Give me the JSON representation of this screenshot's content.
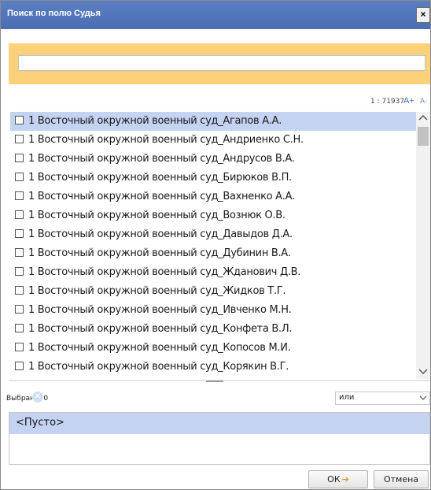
{
  "dialog": {
    "title": "Поиск по полю Судья",
    "close_label": "×"
  },
  "search": {
    "value": "",
    "placeholder": ""
  },
  "list_tools": {
    "counter": "1 : 71937",
    "font_increase": "A+",
    "font_decrease": "A-"
  },
  "items": [
    {
      "label": "1 Восточный окружной военный суд_Агапов А.А.",
      "selected": true
    },
    {
      "label": "1 Восточный окружной военный суд_Андриенко С.Н.",
      "selected": false
    },
    {
      "label": "1 Восточный окружной военный суд_Андрусов В.А.",
      "selected": false
    },
    {
      "label": "1 Восточный окружной военный суд_Бирюков В.П.",
      "selected": false
    },
    {
      "label": "1 Восточный окружной военный суд_Вахненко А.А.",
      "selected": false
    },
    {
      "label": "1 Восточный окружной военный суд_Вознюк О.В.",
      "selected": false
    },
    {
      "label": "1 Восточный окружной военный суд_Давыдов Д.А.",
      "selected": false
    },
    {
      "label": "1 Восточный окружной военный суд_Дубинин В.А.",
      "selected": false
    },
    {
      "label": "1 Восточный окружной военный суд_Жданович Д.В.",
      "selected": false
    },
    {
      "label": "1 Восточный окружной военный суд_Жидков Т.Г.",
      "selected": false
    },
    {
      "label": "1 Восточный окружной военный суд_Ивченко М.Н.",
      "selected": false
    },
    {
      "label": "1 Восточный окружной военный суд_Конфета В.Л.",
      "selected": false
    },
    {
      "label": "1 Восточный окружной военный суд_Копосов М.И.",
      "selected": false
    },
    {
      "label": "1 Восточный окружной военный суд_Корякин В.Г.",
      "selected": false
    }
  ],
  "selection": {
    "label": "Выбрано: 0",
    "operator": "или",
    "result": "<Пусто>"
  },
  "buttons": {
    "ok": "ОК",
    "cancel": "Отмена"
  },
  "icons": {
    "scroll_up": "chevron-up-icon",
    "scroll_down": "chevron-down-icon",
    "clear": "clear-icon",
    "ok_arrow": "arrow-right-icon"
  },
  "colors": {
    "titlebar": "#4a6db4",
    "search_panel": "#fdd17a",
    "selection_highlight": "#c3d3f1",
    "ok_arrow": "#e8962a"
  }
}
